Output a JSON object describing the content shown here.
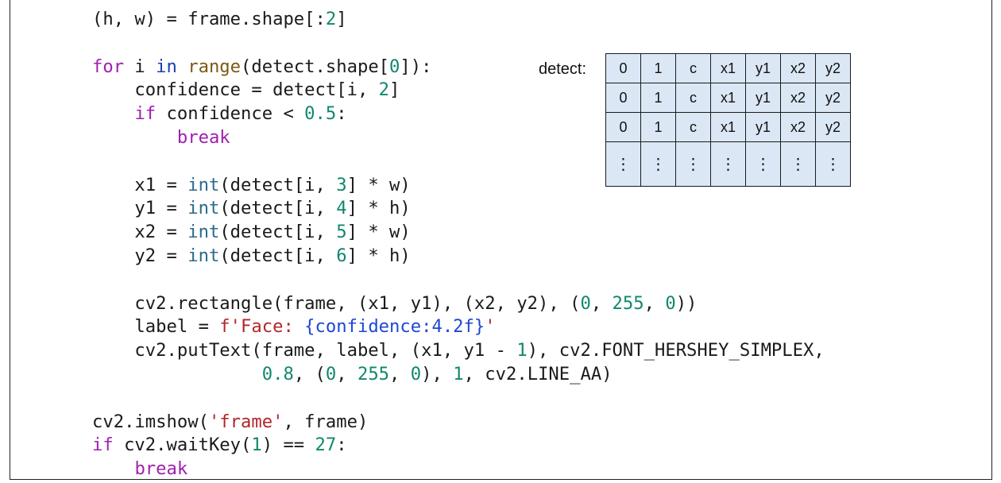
{
  "code_lines": [
    [
      [
        "text",
        "(h, w) = frame.shape[:"
      ],
      [
        "num",
        "2"
      ],
      [
        "text",
        "]"
      ]
    ],
    [],
    [
      [
        "kw",
        "for"
      ],
      [
        "text",
        " i "
      ],
      [
        "kwb",
        "in"
      ],
      [
        "text",
        " "
      ],
      [
        "fn",
        "range"
      ],
      [
        "text",
        "(detect.shape["
      ],
      [
        "num",
        "0"
      ],
      [
        "text",
        "]):"
      ]
    ],
    [
      [
        "text",
        "    confidence = detect[i, "
      ],
      [
        "num",
        "2"
      ],
      [
        "text",
        "]"
      ]
    ],
    [
      [
        "text",
        "    "
      ],
      [
        "kw",
        "if"
      ],
      [
        "text",
        " confidence < "
      ],
      [
        "num",
        "0.5"
      ],
      [
        "text",
        ":"
      ]
    ],
    [
      [
        "text",
        "        "
      ],
      [
        "kw",
        "break"
      ]
    ],
    [],
    [
      [
        "text",
        "    x1 = "
      ],
      [
        "bi",
        "int"
      ],
      [
        "text",
        "(detect[i, "
      ],
      [
        "num",
        "3"
      ],
      [
        "text",
        "] * w)"
      ]
    ],
    [
      [
        "text",
        "    y1 = "
      ],
      [
        "bi",
        "int"
      ],
      [
        "text",
        "(detect[i, "
      ],
      [
        "num",
        "4"
      ],
      [
        "text",
        "] * h)"
      ]
    ],
    [
      [
        "text",
        "    x2 = "
      ],
      [
        "bi",
        "int"
      ],
      [
        "text",
        "(detect[i, "
      ],
      [
        "num",
        "5"
      ],
      [
        "text",
        "] * w)"
      ]
    ],
    [
      [
        "text",
        "    y2 = "
      ],
      [
        "bi",
        "int"
      ],
      [
        "text",
        "(detect[i, "
      ],
      [
        "num",
        "6"
      ],
      [
        "text",
        "] * h)"
      ]
    ],
    [],
    [
      [
        "text",
        "    cv2.rectangle(frame, (x1, y1), (x2, y2), ("
      ],
      [
        "num",
        "0"
      ],
      [
        "text",
        ", "
      ],
      [
        "num",
        "255"
      ],
      [
        "text",
        ", "
      ],
      [
        "num",
        "0"
      ],
      [
        "text",
        "))"
      ]
    ],
    [
      [
        "text",
        "    label = "
      ],
      [
        "str",
        "f'Face: "
      ],
      [
        "fbr",
        "{confidence:4.2f}"
      ],
      [
        "str",
        "'"
      ]
    ],
    [
      [
        "text",
        "    cv2.putText(frame, label, (x1, y1 - "
      ],
      [
        "num",
        "1"
      ],
      [
        "text",
        "), cv2.FONT_HERSHEY_SIMPLEX,"
      ]
    ],
    [
      [
        "text",
        "                "
      ],
      [
        "num",
        "0.8"
      ],
      [
        "text",
        ", ("
      ],
      [
        "num",
        "0"
      ],
      [
        "text",
        ", "
      ],
      [
        "num",
        "255"
      ],
      [
        "text",
        ", "
      ],
      [
        "num",
        "0"
      ],
      [
        "text",
        "), "
      ],
      [
        "num",
        "1"
      ],
      [
        "text",
        ", cv2.LINE_AA)"
      ]
    ],
    [],
    [
      [
        "text",
        "cv2.imshow("
      ],
      [
        "str",
        "'frame'"
      ],
      [
        "text",
        ", frame)"
      ]
    ],
    [
      [
        "kw",
        "if"
      ],
      [
        "text",
        " cv2.waitKey("
      ],
      [
        "num",
        "1"
      ],
      [
        "text",
        ") == "
      ],
      [
        "num",
        "27"
      ],
      [
        "text",
        ":"
      ]
    ],
    [
      [
        "text",
        "    "
      ],
      [
        "kw",
        "break"
      ]
    ]
  ],
  "detect_label": "detect:",
  "detect_table": {
    "rows": [
      [
        "0",
        "1",
        "c",
        "x1",
        "y1",
        "x2",
        "y2"
      ],
      [
        "0",
        "1",
        "c",
        "x1",
        "y1",
        "x2",
        "y2"
      ],
      [
        "0",
        "1",
        "c",
        "x1",
        "y1",
        "x2",
        "y2"
      ],
      [
        "⋮",
        "⋮",
        "⋮",
        "⋮",
        "⋮",
        "⋮",
        "⋮"
      ]
    ]
  }
}
